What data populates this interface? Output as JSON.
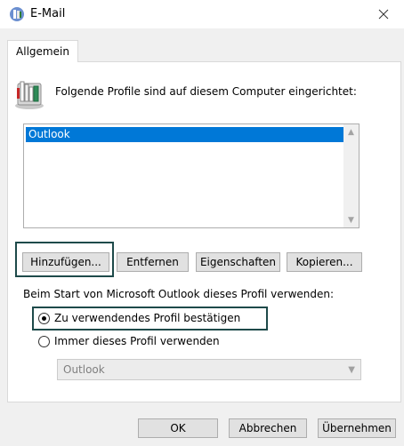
{
  "window": {
    "title": "E-Mail",
    "close_glyph": "✕"
  },
  "tabs": [
    {
      "label": "Allgemein"
    }
  ],
  "prompt": "Folgende Profile sind auf diesem Computer eingerichtet:",
  "profiles": [
    {
      "name": "Outlook",
      "selected": true
    }
  ],
  "buttons": {
    "add": "Hinzufügen...",
    "remove": "Entfernen",
    "properties": "Eigenschaften",
    "copy": "Kopieren..."
  },
  "startup": {
    "caption": "Beim Start von Microsoft Outlook dieses Profil verwenden:",
    "option_confirm": "Zu verwendendes Profil bestätigen",
    "option_always": "Immer dieses Profil verwenden",
    "selected_option": "option_confirm",
    "profile_select_value": "Outlook"
  },
  "footer": {
    "ok": "OK",
    "cancel": "Abbrechen",
    "apply": "Übernehmen"
  },
  "colors": {
    "selection": "#0078d7",
    "focus_ring": "#1e4a4a"
  }
}
